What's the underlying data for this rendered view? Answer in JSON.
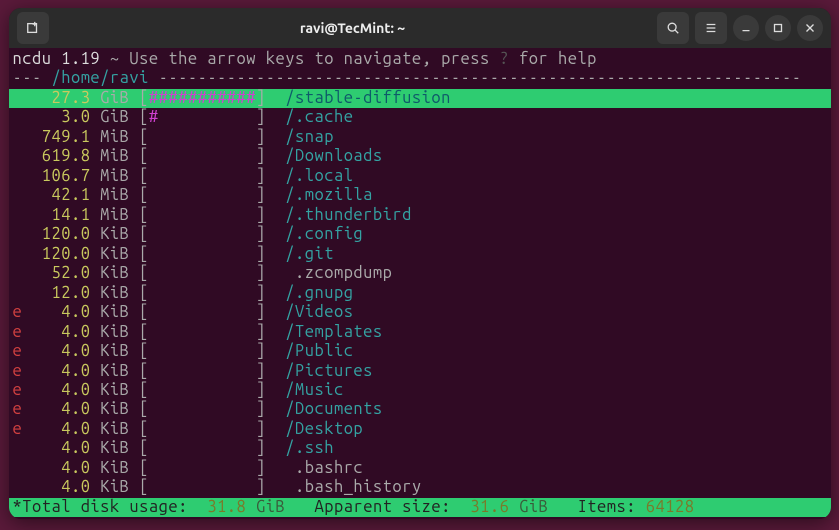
{
  "title": "ravi@TecMint: ~",
  "hint": {
    "app": "ncdu 1.19",
    "text_a": " ~ Use the arrow keys to navigate, press ",
    "key": "?",
    "text_b": " for help"
  },
  "path": {
    "prefix": "--- ",
    "value": "/home/ravi"
  },
  "rows": [
    {
      "flag": " ",
      "size": "27.3",
      "unit": "GiB",
      "bar": "###########",
      "dir": true,
      "name": "stable-diffusion",
      "sel": true
    },
    {
      "flag": " ",
      "size": "3.0",
      "unit": "GiB",
      "bar": "#          ",
      "dir": true,
      "name": ".cache"
    },
    {
      "flag": " ",
      "size": "749.1",
      "unit": "MiB",
      "bar": "           ",
      "dir": true,
      "name": "snap"
    },
    {
      "flag": " ",
      "size": "619.8",
      "unit": "MiB",
      "bar": "           ",
      "dir": true,
      "name": "Downloads"
    },
    {
      "flag": " ",
      "size": "106.7",
      "unit": "MiB",
      "bar": "           ",
      "dir": true,
      "name": ".local"
    },
    {
      "flag": " ",
      "size": "42.1",
      "unit": "MiB",
      "bar": "           ",
      "dir": true,
      "name": ".mozilla"
    },
    {
      "flag": " ",
      "size": "14.1",
      "unit": "MiB",
      "bar": "           ",
      "dir": true,
      "name": ".thunderbird"
    },
    {
      "flag": " ",
      "size": "120.0",
      "unit": "KiB",
      "bar": "           ",
      "dir": true,
      "name": ".config"
    },
    {
      "flag": " ",
      "size": "120.0",
      "unit": "KiB",
      "bar": "           ",
      "dir": true,
      "name": ".git"
    },
    {
      "flag": " ",
      "size": "52.0",
      "unit": "KiB",
      "bar": "           ",
      "dir": false,
      "name": ".zcompdump"
    },
    {
      "flag": " ",
      "size": "12.0",
      "unit": "KiB",
      "bar": "           ",
      "dir": true,
      "name": ".gnupg"
    },
    {
      "flag": "e",
      "size": "4.0",
      "unit": "KiB",
      "bar": "           ",
      "dir": true,
      "name": "Videos"
    },
    {
      "flag": "e",
      "size": "4.0",
      "unit": "KiB",
      "bar": "           ",
      "dir": true,
      "name": "Templates"
    },
    {
      "flag": "e",
      "size": "4.0",
      "unit": "KiB",
      "bar": "           ",
      "dir": true,
      "name": "Public"
    },
    {
      "flag": "e",
      "size": "4.0",
      "unit": "KiB",
      "bar": "           ",
      "dir": true,
      "name": "Pictures"
    },
    {
      "flag": "e",
      "size": "4.0",
      "unit": "KiB",
      "bar": "           ",
      "dir": true,
      "name": "Music"
    },
    {
      "flag": "e",
      "size": "4.0",
      "unit": "KiB",
      "bar": "           ",
      "dir": true,
      "name": "Documents"
    },
    {
      "flag": "e",
      "size": "4.0",
      "unit": "KiB",
      "bar": "           ",
      "dir": true,
      "name": "Desktop"
    },
    {
      "flag": " ",
      "size": "4.0",
      "unit": "KiB",
      "bar": "           ",
      "dir": true,
      "name": ".ssh"
    },
    {
      "flag": " ",
      "size": "4.0",
      "unit": "KiB",
      "bar": "           ",
      "dir": false,
      "name": ".bashrc"
    },
    {
      "flag": " ",
      "size": "4.0",
      "unit": "KiB",
      "bar": "           ",
      "dir": false,
      "name": ".bash_history"
    }
  ],
  "footer": {
    "star": "*",
    "label_total": "Total disk usage:",
    "total": "31.8",
    "unit1": "GiB",
    "label_app": "Apparent size:",
    "apparent": "31.6",
    "unit2": "GiB",
    "label_items": "Items:",
    "items": "64128"
  }
}
